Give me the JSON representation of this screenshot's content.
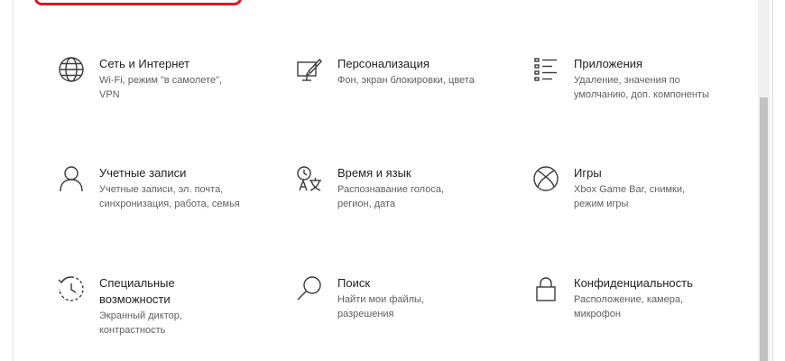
{
  "tiles": [
    {
      "title": "Сеть и Интернет",
      "desc1": "Wi-Fi, режим \"в самолете\",",
      "desc2": "VPN",
      "icon": "globe-icon"
    },
    {
      "title": "Персонализация",
      "desc1": "Фон, экран блокировки, цвета",
      "desc2": "",
      "icon": "personalization-icon"
    },
    {
      "title": "Приложения",
      "desc1": "Удаление, значения по",
      "desc2": "умолчанию, доп. компоненты",
      "icon": "apps-list-icon"
    },
    {
      "title": "Учетные записи",
      "desc1": "Учетные записи, эл. почта,",
      "desc2": "синхронизация, работа, семья",
      "icon": "person-icon"
    },
    {
      "title": "Время и язык",
      "desc1": "Распознавание голоса,",
      "desc2": "регион, дата",
      "icon": "time-language-icon"
    },
    {
      "title": "Игры",
      "desc1": "Xbox Game Bar, снимки,",
      "desc2": "режим игры",
      "icon": "xbox-icon"
    },
    {
      "title": "Специальные",
      "title2": "возможности",
      "desc1": "Экранный диктор,",
      "desc2": "контрастность",
      "icon": "ease-of-access-icon"
    },
    {
      "title": "Поиск",
      "desc1": "Найти мои файлы,",
      "desc2": "разрешения",
      "icon": "search-icon"
    },
    {
      "title": "Конфиденциальность",
      "desc1": "Расположение, камера,",
      "desc2": "микрофон",
      "icon": "lock-icon"
    }
  ],
  "colors": {
    "highlight": "#e81123",
    "title": "#1f1f1f",
    "desc": "#5f5f5f",
    "icon": "#3a3a3a"
  }
}
